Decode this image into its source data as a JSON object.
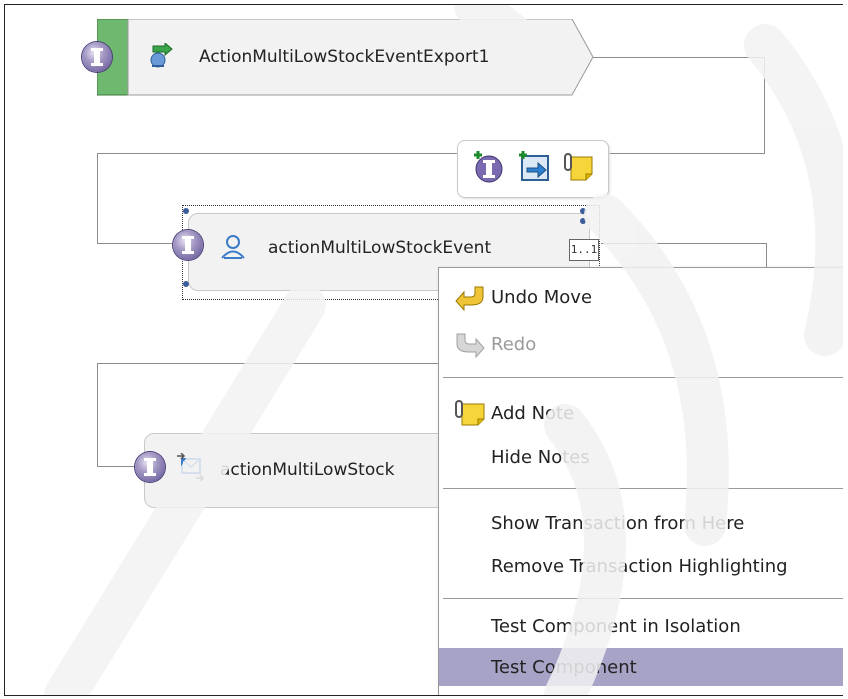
{
  "export_node": {
    "label": "ActionMultiLowStockEventExport1",
    "icon": "export-icon"
  },
  "component_node": {
    "label": "actionMultiLowStockEvent",
    "icon": "java-component-icon",
    "badge": "1..1"
  },
  "lower_node": {
    "label": "actionMultiLowStock",
    "icon": "map-component-icon"
  },
  "palette": {
    "icons": [
      "add-interface-icon",
      "add-reference-icon",
      "add-note-icon"
    ]
  },
  "context_menu": {
    "items": [
      {
        "label": "Undo Move",
        "icon": "undo-icon",
        "enabled": true
      },
      {
        "label": "Redo",
        "icon": "redo-icon",
        "enabled": false
      },
      {
        "label": "Add Note",
        "icon": "note-icon",
        "enabled": true
      },
      {
        "label": "Hide Notes",
        "enabled": true
      },
      {
        "label": "Show Transaction from Here",
        "enabled": true
      },
      {
        "label": "Remove Transaction Highlighting",
        "enabled": true
      },
      {
        "label": "Test Component in Isolation",
        "enabled": true
      },
      {
        "label": "Test Component",
        "enabled": true,
        "selected": true
      }
    ]
  },
  "colors": {
    "selection": "#a7a3c6",
    "interface_badge": "#5b4c91",
    "export_tab": "#6fb86f",
    "wire": "#8c8c8c"
  }
}
